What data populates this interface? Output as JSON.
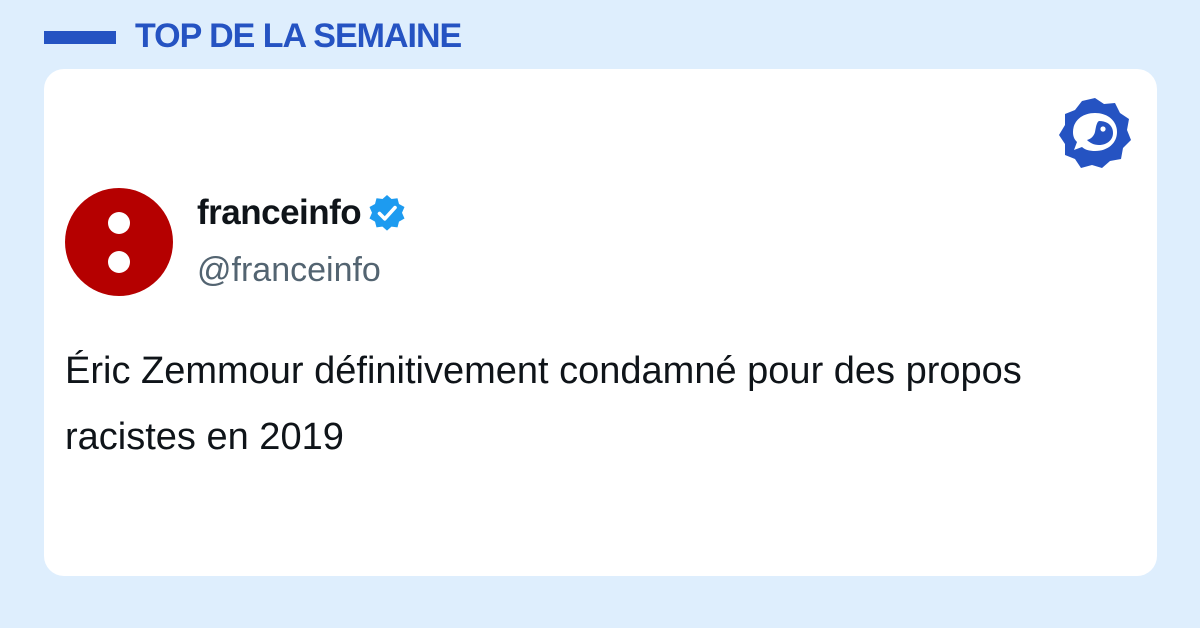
{
  "header": {
    "title": "TOP DE LA SEMAINE"
  },
  "tweet": {
    "author_name": "franceinfo",
    "author_handle": "@franceinfo",
    "text": "Éric Zemmour définitivement condamné pour des propos racistes en 2019",
    "verified": true
  },
  "icons": {
    "brand": "brand-bird-logo-icon",
    "verified": "verified-badge-icon",
    "avatar": "franceinfo-logo-avatar"
  },
  "colors": {
    "background": "#deeefd",
    "accent": "#2553c2",
    "card": "#ffffff",
    "avatar_red": "#b50000",
    "verified_blue": "#1d9bf0",
    "text_primary": "#0f1419",
    "text_secondary": "#536471"
  }
}
